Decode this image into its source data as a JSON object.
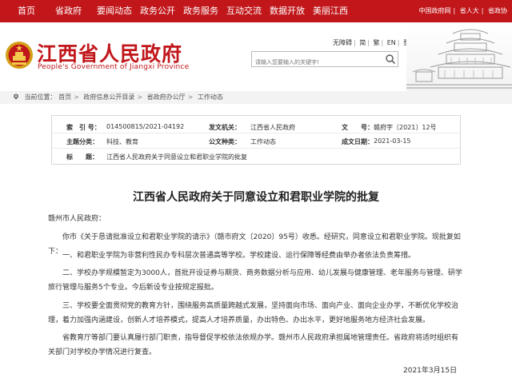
{
  "topnav": {
    "items": [
      "首页",
      "省政府",
      "要闻动态",
      "政务公开",
      "政务服务",
      "互动交流",
      "数据开放",
      "美丽江西"
    ],
    "right_links": [
      "中国政府网",
      "省人大",
      "省政协"
    ]
  },
  "header": {
    "title": "江西省人民政府",
    "subtitle": "People's Government of Jiangxi Province",
    "util_links": [
      "无障碍",
      "简",
      "繁",
      "EN",
      "登录"
    ],
    "search_placeholder": "请输入您要输入的关键字!"
  },
  "breadcrumb": {
    "prefix": "当前位置：",
    "items": [
      "首页",
      "政府信息公开目录",
      "省政府办公厅",
      "工作动态"
    ]
  },
  "info": {
    "index_label": "索　引 号：",
    "index_value": "014500815/2021-04192",
    "org_label": "发文机关：",
    "org_value": "江西省人民政府",
    "docno_label": "文　　号：",
    "docno_value": "赣府字〔2021〕12号",
    "topic_label": "主题分类：",
    "topic_value": "科技、教育",
    "form_label": "公文种类：",
    "form_value": "工作动态",
    "date_label": "成文日期：",
    "date_value": "2021-03-15",
    "subject_label": "标　　题：",
    "subject_value": "江西省人民政府关于同意设立和君职业学院的批复"
  },
  "article": {
    "title": "江西省人民政府关于同意设立和君职业学院的批复",
    "salutation": "赣州市人民政府：",
    "p1": "你市《关于恳请批准设立和君职业学院的请示》（赣市府文〔2020〕95号）收悉。经研究，同意设立和君职业学院。现批复如下：",
    "p2": "一、和君职业学院为非营利性民办专科层次普通高等学校。学校建设、运行保障等经费由举办者依法负责筹措。",
    "p3": "二、学校办学规模暂定为3000人，首批开设证券与期货、商务数据分析与应用、幼儿发展与健康管理、老年服务与管理、研学旅行管理与服务5个专业。今后新设专业按规定报批。",
    "p4": "三、学校要全面贯彻党的教育方针，围绕服务高质量跨越式发展，坚持面向市场、面向产业、面向企业办学，不断优化学校治理，着力加强内涵建设，创新人才培养模式，提高人才培养质量，办出特色、办出水平，更好地服务地方经济社会发展。",
    "p5": "省教育厅等部门要认真履行部门职责，指导督促学校依法依规办学。赣州市人民政府承担属地管理责任。省政府将适时组织有关部门对学校办学情况进行复查。",
    "date": "2021年3月15日"
  },
  "colors": {
    "brand_red": "#c1171b"
  }
}
